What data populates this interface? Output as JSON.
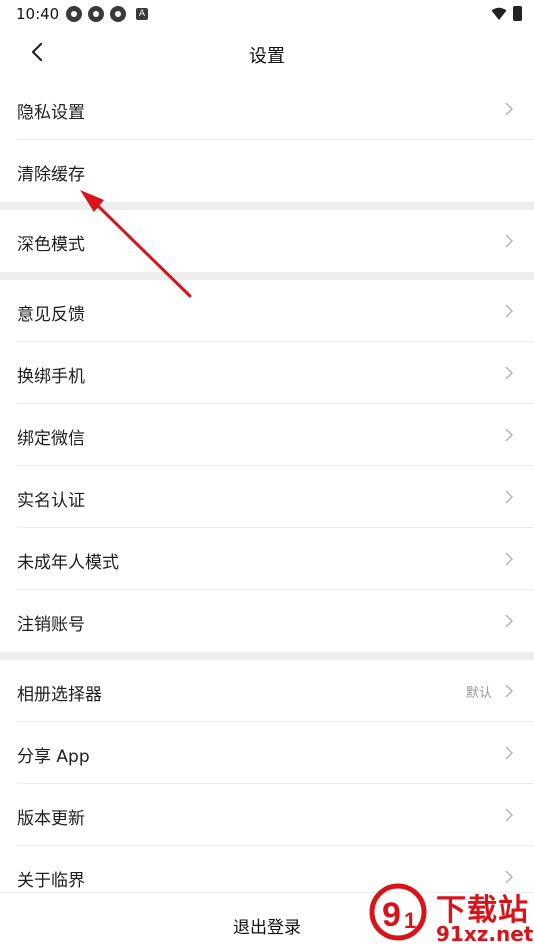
{
  "status": {
    "time": "10:40",
    "extra_icon": "A"
  },
  "header": {
    "title": "设置"
  },
  "sections": [
    {
      "items": [
        {
          "label": "隐私设置",
          "chevron": true
        },
        {
          "label": "清除缓存",
          "chevron": false
        }
      ]
    },
    {
      "items": [
        {
          "label": "深色模式",
          "chevron": true
        }
      ]
    },
    {
      "items": [
        {
          "label": "意见反馈",
          "chevron": true
        },
        {
          "label": "换绑手机",
          "chevron": true
        },
        {
          "label": "绑定微信",
          "chevron": true
        },
        {
          "label": "实名认证",
          "chevron": true
        },
        {
          "label": "未成年人模式",
          "chevron": true
        },
        {
          "label": "注销账号",
          "chevron": true
        }
      ]
    },
    {
      "items": [
        {
          "label": "相册选择器",
          "value": "默认",
          "chevron": true
        },
        {
          "label": "分享 App",
          "chevron": true
        },
        {
          "label": "版本更新",
          "chevron": true
        },
        {
          "label": "关于临界",
          "chevron": true
        }
      ]
    }
  ],
  "footer": {
    "logout_label": "退出登录"
  },
  "watermark": {
    "title": "下载站",
    "sub": "91xz.net",
    "logo_color": "#d8141b"
  },
  "annotation": {
    "arrow_color": "#d8141b"
  }
}
